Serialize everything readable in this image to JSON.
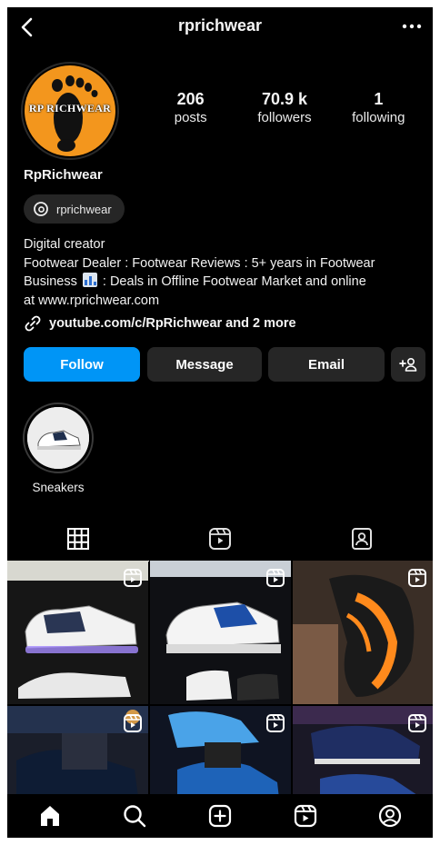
{
  "header": {
    "username": "rprichwear"
  },
  "profile": {
    "avatar_text": "RP RICHWEAR",
    "display_name": "RpRichwear",
    "threads_handle": "rprichwear",
    "bio_lines": [
      "Digital creator",
      "Footwear Dealer : Footwear Reviews : 5+ years in Footwear",
      "Business",
      ": Deals in Offline Footwear Market and online",
      "at www.rprichwear.com"
    ],
    "link_text": "youtube.com/c/RpRichwear and 2 more"
  },
  "stats": [
    {
      "value": "206",
      "label": "posts"
    },
    {
      "value": "70.9 k",
      "label": "followers"
    },
    {
      "value": "1",
      "label": "following"
    }
  ],
  "actions": {
    "follow": "Follow",
    "message": "Message",
    "email": "Email"
  },
  "highlights": [
    {
      "label": "Sneakers"
    }
  ],
  "colors": {
    "background": "#000000",
    "primary_button": "#0095f6",
    "secondary_button": "#262626",
    "avatar_orange": "#f3961d"
  },
  "icons": {
    "back": "chevron-left-icon",
    "more": "ellipsis-icon",
    "threads": "threads-icon",
    "link": "link-icon",
    "add_user": "add-user-icon",
    "posts_tab": "grid-icon",
    "reels_tab": "reels-icon",
    "tagged_tab": "tagged-icon",
    "nav": [
      "home-icon",
      "search-icon",
      "create-icon",
      "reels-icon",
      "profile-icon"
    ]
  }
}
